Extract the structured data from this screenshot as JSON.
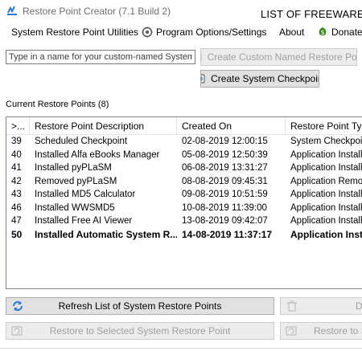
{
  "window": {
    "title": "Restore Point Creator (7.1 Build 2)",
    "watermark": "LIST OF FREEWARE"
  },
  "menu": {
    "items": [
      {
        "label": "System Restore Point Utilities",
        "icon": ""
      },
      {
        "label": "Program Options/Settings",
        "icon": "gear-icon"
      },
      {
        "label": "About",
        "icon": ""
      },
      {
        "label": "Donate",
        "icon": "money-icon"
      }
    ]
  },
  "name_input": {
    "placeholder": "Type in a name for your custom-named System I",
    "value": ""
  },
  "buttons": {
    "create_custom": "Create Custom Named Restore Point",
    "create_checkpoint": "Create System Checkpoint",
    "refresh": "Refresh List of System Restore Points",
    "delete_partial": "D",
    "restore_selected": "Restore to Selected System Restore Point",
    "restore_safe_partial": "Restore to Se"
  },
  "list": {
    "label": "Current Restore Points (8)",
    "columns": [
      ">...",
      "Restore Point Description",
      "Created On",
      "Restore Point Type"
    ],
    "rows": [
      {
        "id": "39",
        "description": "Scheduled Checkpoint",
        "created": "02-08-2019 12:00:15",
        "type": "System Checkpoint",
        "bold": false
      },
      {
        "id": "40",
        "description": "Installed Alfa eBooks Manager",
        "created": "05-08-2019 12:50:39",
        "type": "Application Install",
        "bold": false
      },
      {
        "id": "41",
        "description": "Installed pyPLaSM",
        "created": "06-08-2019 13:31:27",
        "type": "Application Install",
        "bold": false
      },
      {
        "id": "42",
        "description": "Removed pyPLaSM",
        "created": "08-08-2019 09:45:31",
        "type": "Application Removal",
        "bold": false
      },
      {
        "id": "43",
        "description": "Installed MD5 Calculator",
        "created": "09-08-2019 10:51:59",
        "type": "Application Install",
        "bold": false
      },
      {
        "id": "46",
        "description": "Installed WWSMD5",
        "created": "10-08-2019 11:39:00",
        "type": "Application Install",
        "bold": false
      },
      {
        "id": "47",
        "description": "Installed Free AI Viewer",
        "created": "13-08-2019 09:42:07",
        "type": "Application Install",
        "bold": false
      },
      {
        "id": "50",
        "description": "Installed Automatic System R...",
        "created": "14-08-2019 11:37:17",
        "type": "Application Install",
        "bold": true
      }
    ]
  },
  "colors": {
    "accent_blue": "#2a78d6",
    "donate_green": "#3a8a1e",
    "disabled_text": "#a0a0a0"
  }
}
